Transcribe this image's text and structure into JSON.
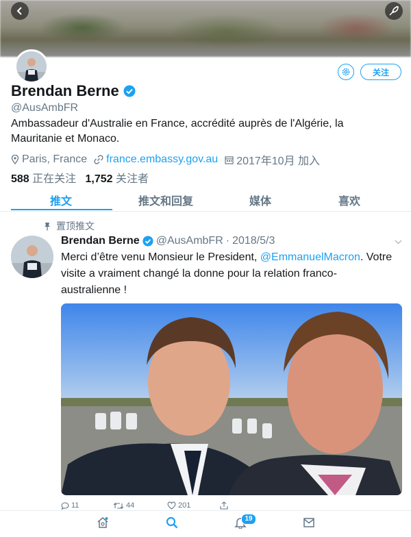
{
  "profile": {
    "name": "Brendan Berne",
    "handle": "@AusAmbFR",
    "bio": "Ambassadeur d'Australie en France, accrédité auprès de l'Algérie, la Mauritanie et Monaco.",
    "location": "Paris, France",
    "website": "france.embassy.gov.au",
    "joined": "2017年10月 加入",
    "following_count": "588",
    "following_label": "正在关注",
    "followers_count": "1,752",
    "followers_label": "关注者",
    "follow_label": "关注"
  },
  "tabs": [
    {
      "label": "推文",
      "active": true
    },
    {
      "label": "推文和回复",
      "active": false
    },
    {
      "label": "媒体",
      "active": false
    },
    {
      "label": "喜欢",
      "active": false
    }
  ],
  "tweet": {
    "pinned_label": "置顶推文",
    "author_name": "Brendan Berne",
    "author_handle": "@AusAmbFR",
    "separator": "·",
    "date": "2018/5/3",
    "text_before": "Merci d’être venu Monsieur le President, ",
    "mention": "@EmmanuelMacron",
    "text_after": ". Votre visite a vraiment changé la donne pour la relation franco-australienne !",
    "replies": "11",
    "retweets": "44",
    "likes": "201"
  },
  "nav": {
    "notification_badge": "19"
  },
  "colors": {
    "accent": "#1da1f2",
    "muted": "#657786",
    "text": "#14171a"
  }
}
